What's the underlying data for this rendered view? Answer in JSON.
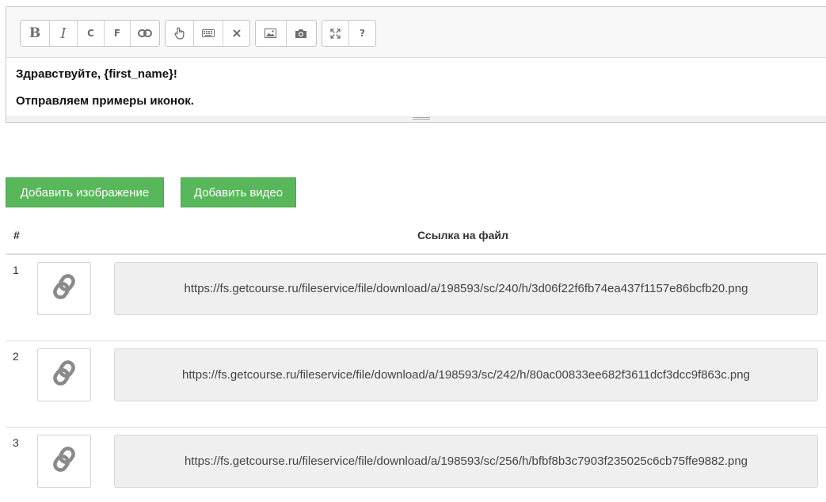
{
  "toolbar": {
    "group1": [
      {
        "name": "bold",
        "label": "B"
      },
      {
        "name": "italic",
        "label": "I"
      },
      {
        "name": "c",
        "label": "C"
      },
      {
        "name": "f",
        "label": "F"
      },
      {
        "name": "link",
        "icon": "link-icon"
      }
    ],
    "group2": [
      {
        "name": "pointer",
        "icon": "hand-pointer-icon"
      },
      {
        "name": "keyboard",
        "icon": "keyboard-icon"
      },
      {
        "name": "remove",
        "icon": "close-icon"
      }
    ],
    "group3": [
      {
        "name": "image",
        "icon": "image-icon"
      },
      {
        "name": "camera",
        "icon": "camera-icon"
      }
    ],
    "group4": [
      {
        "name": "fullscreen",
        "icon": "expand-icon"
      },
      {
        "name": "help",
        "label": "?"
      }
    ]
  },
  "editor": {
    "line1": "Здравствуйте, {first_name}!",
    "line2": "Отправляем примеры иконок."
  },
  "buttons": {
    "add_image": "Добавить изображение",
    "add_video": "Добавить видео"
  },
  "table": {
    "col_num": "#",
    "col_link": "Ссылка на файл",
    "rows": [
      {
        "num": "1",
        "thumb_icon": "link-icon",
        "url": "https://fs.getcourse.ru/fileservice/file/download/a/198593/sc/240/h/3d06f22f6fb74ea437f1157e86bcfb20.png"
      },
      {
        "num": "2",
        "thumb_icon": "link-icon",
        "url": "https://fs.getcourse.ru/fileservice/file/download/a/198593/sc/242/h/80ac00833ee682f3611dcf3dcc9f863c.png"
      },
      {
        "num": "3",
        "thumb_icon": "link-icon",
        "url": "https://fs.getcourse.ru/fileservice/file/download/a/198593/sc/256/h/bfbf8b3c7903f235025c6cb75ffe9882.png"
      }
    ]
  },
  "colors": {
    "accent_green": "#58b75a",
    "url_box_bg": "#efefef",
    "icon_gray": "#8a8a8a"
  }
}
